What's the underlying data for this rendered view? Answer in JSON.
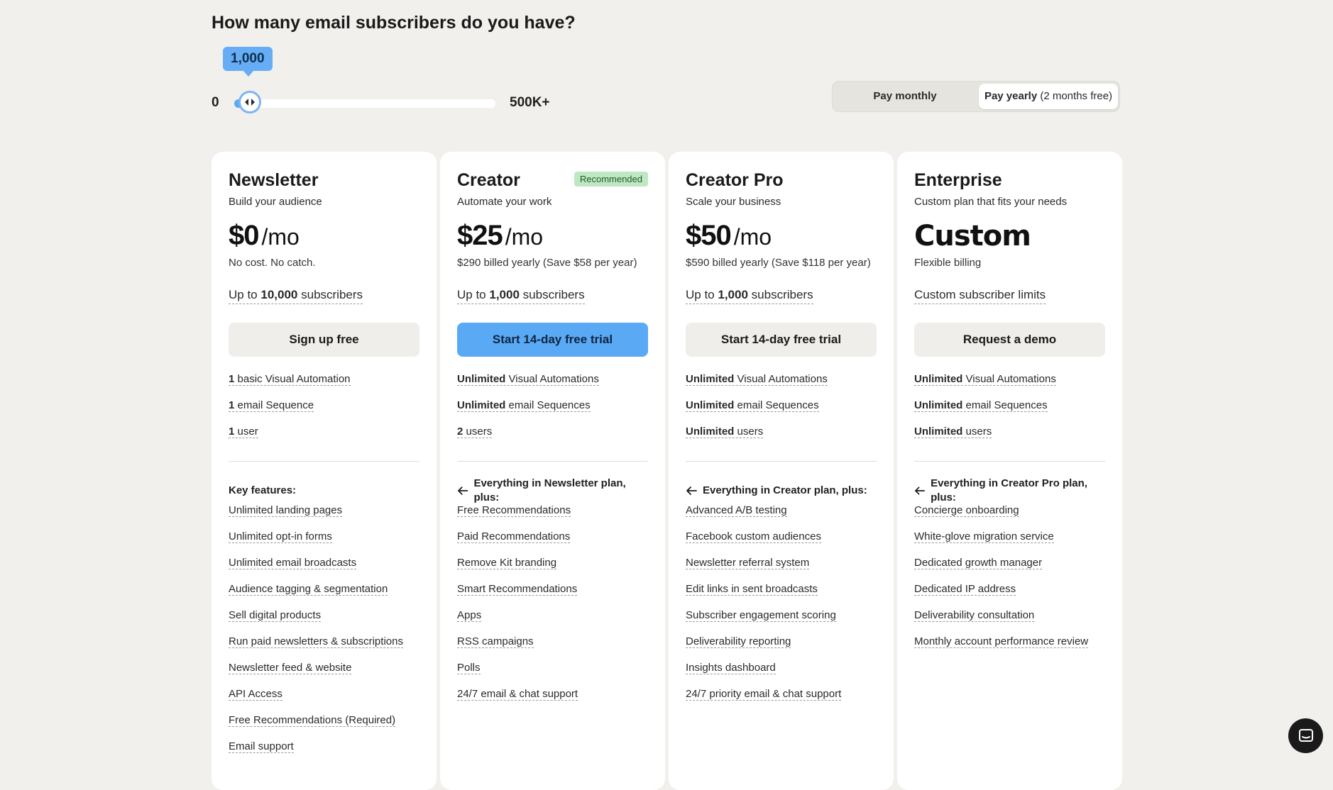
{
  "question": "How many email subscribers do you have?",
  "slider": {
    "min_label": "0",
    "max_label": "500K+",
    "value_label": "1,000",
    "level_fraction": 0.03
  },
  "billing": {
    "monthly_label": "Pay monthly",
    "yearly_label": "Pay yearly",
    "yearly_note": "(2 months free)",
    "selected": "yearly"
  },
  "colors": {
    "accent": "#5aa9f5",
    "background": "#f1f0ec",
    "badge_bg": "#bfe7c4"
  },
  "plans": [
    {
      "name": "Newsletter",
      "badge": "",
      "tagline": "Build your audience",
      "price_amount": "$0",
      "price_unit": "/mo",
      "billing_note": "No cost. No catch.",
      "limit_prefix": "Up to",
      "limit_value": "10,000",
      "limit_suffix": "subscribers",
      "cta": "Sign up free",
      "quotas": [
        {
          "bold": "1",
          "text": "basic Visual Automation"
        },
        {
          "bold": "1",
          "text": "email Sequence"
        },
        {
          "bold": "1",
          "text": "user"
        }
      ],
      "features_heading": "Key features:",
      "features": [
        "Unlimited landing pages",
        "Unlimited opt-in forms",
        "Unlimited email broadcasts",
        "Audience tagging & segmentation",
        "Sell digital products",
        "Run paid newsletters & subscriptions",
        "Newsletter feed & website",
        "API Access",
        "Free Recommendations (Required)",
        "Email support"
      ]
    },
    {
      "name": "Creator",
      "badge": "Recommended",
      "tagline": "Automate your work",
      "price_amount": "$25",
      "price_unit": "/mo",
      "billing_note": "$290 billed yearly (Save $58 per year)",
      "limit_prefix": "Up to",
      "limit_value": "1,000",
      "limit_suffix": "subscribers",
      "cta": "Start 14-day free trial",
      "quotas": [
        {
          "bold": "Unlimited",
          "text": "Visual Automations"
        },
        {
          "bold": "Unlimited",
          "text": "email Sequences"
        },
        {
          "bold": "2",
          "text": "users"
        }
      ],
      "features_heading": "Everything in Newsletter plan, plus:",
      "features": [
        "Free Recommendations",
        "Paid Recommendations",
        "Remove Kit branding",
        "Smart Recommendations",
        "Apps",
        "RSS campaigns",
        "Polls",
        "24/7 email & chat support"
      ]
    },
    {
      "name": "Creator Pro",
      "badge": "",
      "tagline": "Scale your business",
      "price_amount": "$50",
      "price_unit": "/mo",
      "billing_note": "$590 billed yearly (Save $118 per year)",
      "limit_prefix": "Up to",
      "limit_value": "1,000",
      "limit_suffix": "subscribers",
      "cta": "Start 14-day free trial",
      "quotas": [
        {
          "bold": "Unlimited",
          "text": "Visual Automations"
        },
        {
          "bold": "Unlimited",
          "text": "email Sequences"
        },
        {
          "bold": "Unlimited",
          "text": "users"
        }
      ],
      "features_heading": "Everything in Creator plan, plus:",
      "features": [
        "Advanced A/B testing",
        "Facebook custom audiences",
        "Newsletter referral system",
        "Edit links in sent broadcasts",
        "Subscriber engagement scoring",
        "Deliverability reporting",
        "Insights dashboard",
        "24/7 priority email & chat support"
      ]
    },
    {
      "name": "Enterprise",
      "badge": "",
      "tagline": "Custom plan that fits your needs",
      "price_amount": "Custom",
      "price_unit": "",
      "billing_note": "Flexible billing",
      "limit_prefix": "",
      "limit_value": "",
      "limit_suffix": "Custom subscriber limits",
      "cta": "Request a demo",
      "quotas": [
        {
          "bold": "Unlimited",
          "text": "Visual Automations"
        },
        {
          "bold": "Unlimited",
          "text": "email Sequences"
        },
        {
          "bold": "Unlimited",
          "text": "users"
        }
      ],
      "features_heading": "Everything in Creator Pro plan, plus:",
      "features": [
        "Concierge onboarding",
        "White-glove migration service",
        "Dedicated growth manager",
        "Dedicated IP address",
        "Deliverability consultation",
        "Monthly account performance review"
      ]
    }
  ]
}
